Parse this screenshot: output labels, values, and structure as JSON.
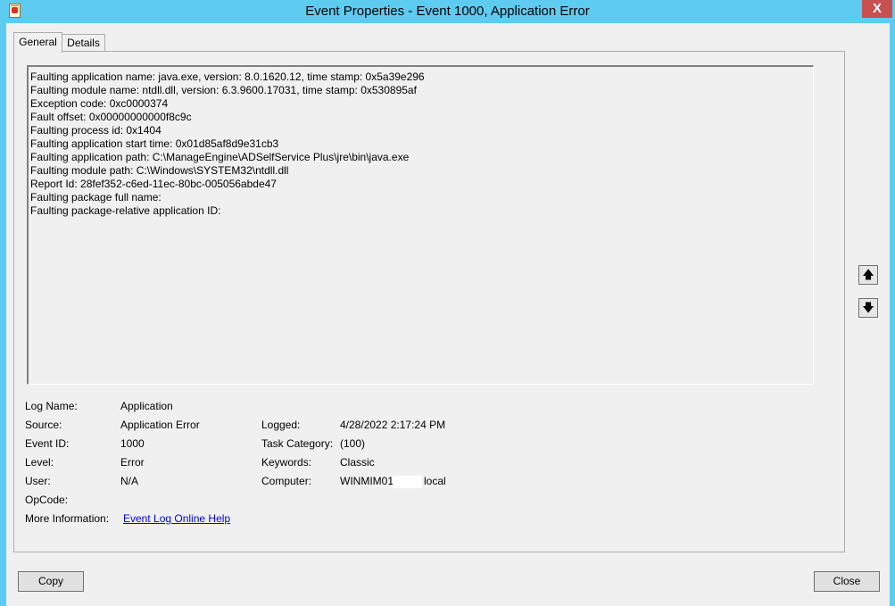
{
  "window": {
    "title": "Event Properties - Event 1000, Application Error",
    "close_glyph": "X",
    "icon": "event-viewer-icon"
  },
  "tabs": [
    {
      "label": "General",
      "selected": true
    },
    {
      "label": "Details",
      "selected": false
    }
  ],
  "description_lines": [
    "Faulting application name: java.exe, version: 8.0.1620.12, time stamp: 0x5a39e296",
    "Faulting module name: ntdll.dll, version: 6.3.9600.17031, time stamp: 0x530895af",
    "Exception code: 0xc0000374",
    "Fault offset: 0x00000000000f8c9c",
    "Faulting process id: 0x1404",
    "Faulting application start time: 0x01d85af8d9e31cb3",
    "Faulting application path: C:\\ManageEngine\\ADSelfService Plus\\jre\\bin\\java.exe",
    "Faulting module path: C:\\Windows\\SYSTEM32\\ntdll.dll",
    "Report Id: 28fef352-c6ed-11ec-80bc-005056abde47",
    "Faulting package full name:",
    "Faulting package-relative application ID:"
  ],
  "fields": {
    "log_name": {
      "label": "Log Name:",
      "value": "Application"
    },
    "source": {
      "label": "Source:",
      "value": "Application Error"
    },
    "event_id": {
      "label": "Event ID:",
      "value": "1000"
    },
    "level": {
      "label": "Level:",
      "value": "Error"
    },
    "user": {
      "label": "User:",
      "value": "N/A"
    },
    "opcode": {
      "label": "OpCode:",
      "value": ""
    },
    "more_info": {
      "label": "More Information:",
      "link": "Event Log Online Help"
    },
    "logged": {
      "label": "Logged:",
      "value": "4/28/2022 2:17:24 PM"
    },
    "task_category": {
      "label": "Task Category:",
      "value": "(100)"
    },
    "keywords": {
      "label": "Keywords:",
      "value": "Classic"
    },
    "computer": {
      "label": "Computer:",
      "value_prefix": "WINMIM01.",
      "value_suffix": "local"
    }
  },
  "nav": {
    "up_glyph": "🡅",
    "down_glyph": "🡇"
  },
  "buttons": {
    "copy": "Copy",
    "close": "Close"
  }
}
